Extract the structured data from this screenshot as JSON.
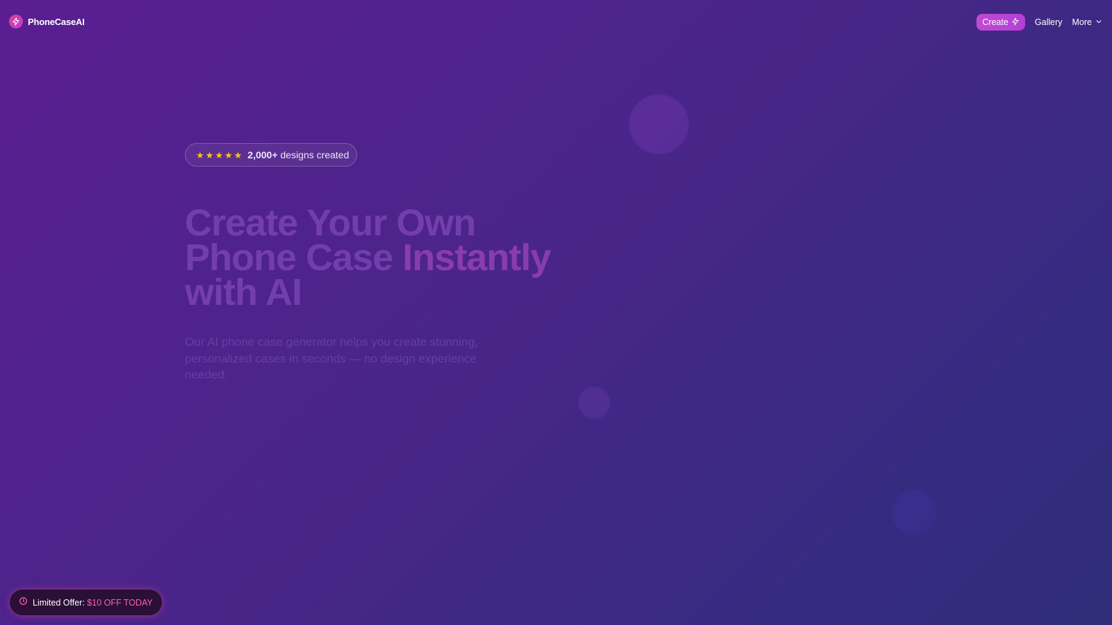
{
  "brand": {
    "name": "PhoneCaseAI",
    "icon": "lightning-icon",
    "icon_color": "#d9428f"
  },
  "nav": {
    "create_label": "Create",
    "create_icon": "lightning-icon",
    "gallery_label": "Gallery",
    "more_label": "More",
    "more_icon": "chevron-down-icon"
  },
  "rating": {
    "stars": 5,
    "count": "2,000+",
    "suffix": " designs created",
    "star_color": "#f5c518"
  },
  "hero": {
    "title_line1": "Create Your Own",
    "title_line2_a": "Phone Case ",
    "title_line2_b": "Instantly",
    "title_line3": "with AI",
    "subtitle": "Our AI phone case generator helps you create stunning, personalized cases in seconds — no design experience needed."
  },
  "offer": {
    "icon": "clock-icon",
    "label": "Limited Offer: ",
    "highlight": "$10 OFF TODAY",
    "highlight_color": "#ff5fb0"
  },
  "colors": {
    "bg_start": "#5a1e91",
    "bg_end": "#2f2d7a",
    "accent": "#c04ad0"
  }
}
